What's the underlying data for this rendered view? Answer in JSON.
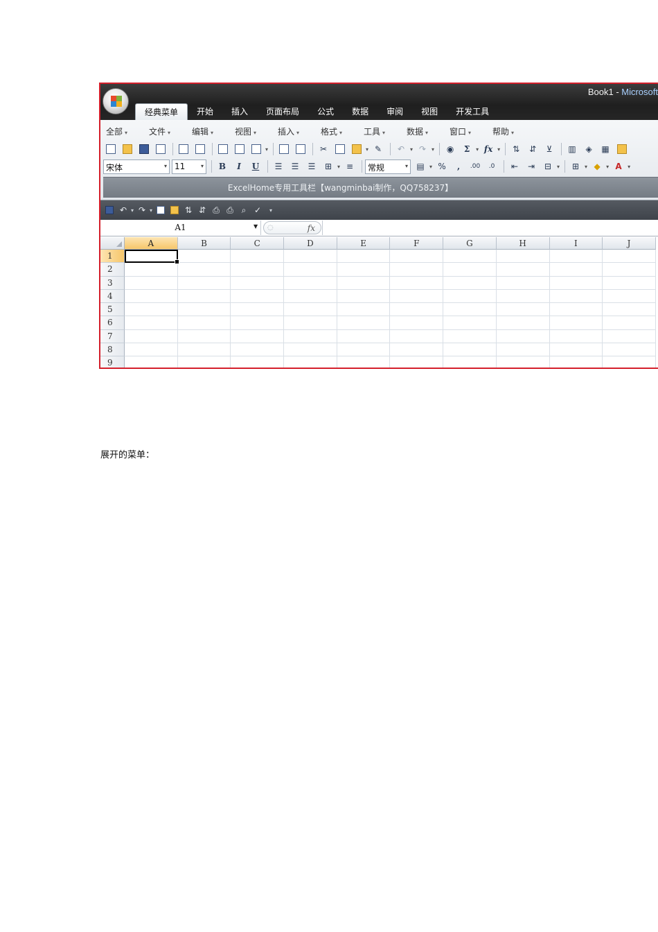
{
  "window": {
    "doc_title": "Book1",
    "separator": " - ",
    "app_title": "Microsoft"
  },
  "ribbon_tabs": [
    {
      "label": "经典菜单",
      "active": true
    },
    {
      "label": "开始"
    },
    {
      "label": "插入"
    },
    {
      "label": "页面布局"
    },
    {
      "label": "公式"
    },
    {
      "label": "数据"
    },
    {
      "label": "审阅"
    },
    {
      "label": "视图"
    },
    {
      "label": "开发工具"
    }
  ],
  "menubar": [
    "全部",
    "文件",
    "编辑",
    "视图",
    "插入",
    "格式",
    "工具",
    "数据",
    "窗口",
    "帮助"
  ],
  "formatting": {
    "font_name": "宋体",
    "font_size": "11",
    "bold": "B",
    "italic": "I",
    "underline": "U",
    "number_format": "常规",
    "percent": "%",
    "comma": ",",
    "sum": "Σ",
    "fx": "fx",
    "font_color": "A"
  },
  "toolbar_caption": "ExcelHome专用工具栏【wangminbai制作，QQ758237】",
  "formula_bar": {
    "name_box": "A1",
    "fx_label": "fx",
    "value": ""
  },
  "columns": [
    "A",
    "B",
    "C",
    "D",
    "E",
    "F",
    "G",
    "H",
    "I",
    "J"
  ],
  "rows": [
    "1",
    "2",
    "3",
    "4",
    "5",
    "6",
    "7",
    "8",
    "9"
  ],
  "selected_cell": {
    "column": "A",
    "row": "1"
  },
  "document_text": "展开的菜单："
}
